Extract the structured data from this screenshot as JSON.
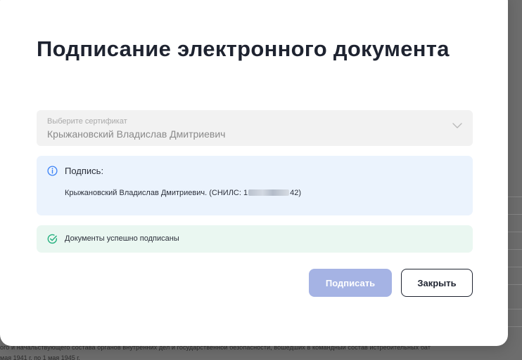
{
  "background": {
    "text_line1": "ого и начальствующего состава органов внутренних дел и государственной безопасности, вошедших в командный состав истребительных бат",
    "text_line2": "мая 1941 г. по 1 мая 1945 г."
  },
  "modal": {
    "title": "Подписание электронного документа",
    "certificate_select": {
      "label": "Выберите сертификат",
      "value": "Крыжановский Владислав Дмитриевич"
    },
    "signature_info": {
      "title": "Подпись:",
      "text_prefix": "Крыжановский Владислав Дмитриевич. (СНИЛС: 1",
      "text_suffix": "42)"
    },
    "success_message": "Документы успешно подписаны",
    "buttons": {
      "sign": "Подписать",
      "close": "Закрыть"
    }
  },
  "colors": {
    "accent_disabled": "#a5b3e4",
    "info_bg": "#ebf3fd",
    "info_icon": "#3b82f6",
    "success_bg": "#eaf7f1",
    "success_icon": "#22b07d",
    "text_dark": "#1e2330"
  },
  "icons": {
    "info": "info-circle-icon",
    "success": "check-circle-icon",
    "chevron": "chevron-down-icon"
  }
}
